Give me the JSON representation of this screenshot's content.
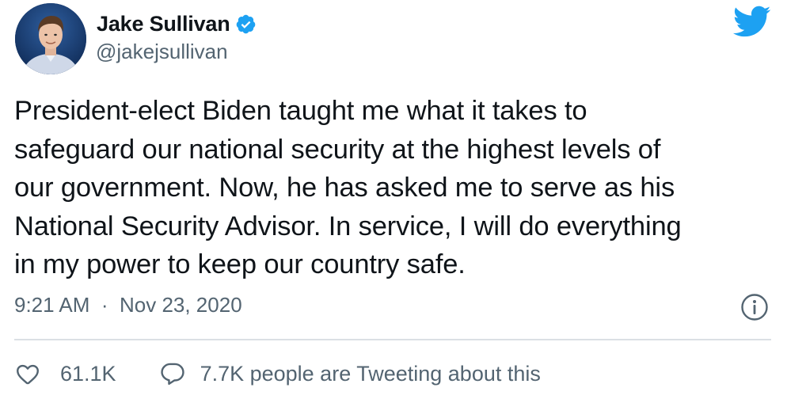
{
  "author": {
    "display_name": "Jake Sullivan",
    "handle": "@jakejsullivan",
    "verified": true
  },
  "tweet": {
    "text_lines": [
      "President-elect Biden taught me what it takes to",
      "safeguard our national security at the highest levels of",
      "our government. Now, he has asked me to serve as his",
      "National Security Advisor. In service, I will do everything",
      "in my power to keep our country safe."
    ],
    "time": "9:21 AM",
    "separator": "·",
    "date": "Nov 23, 2020"
  },
  "actions": {
    "like_count": "61.1K",
    "tweeting_text": "7.7K people are Tweeting about this"
  },
  "icons": {
    "brand": "twitter-bird-icon",
    "verified": "verified-badge-icon",
    "info": "info-icon",
    "like": "heart-icon",
    "reply": "speech-bubble-icon"
  },
  "colors": {
    "brand_blue": "#1da1f2",
    "text_primary": "#0f1419",
    "text_secondary": "#536471",
    "divider": "#dbe0e4"
  }
}
